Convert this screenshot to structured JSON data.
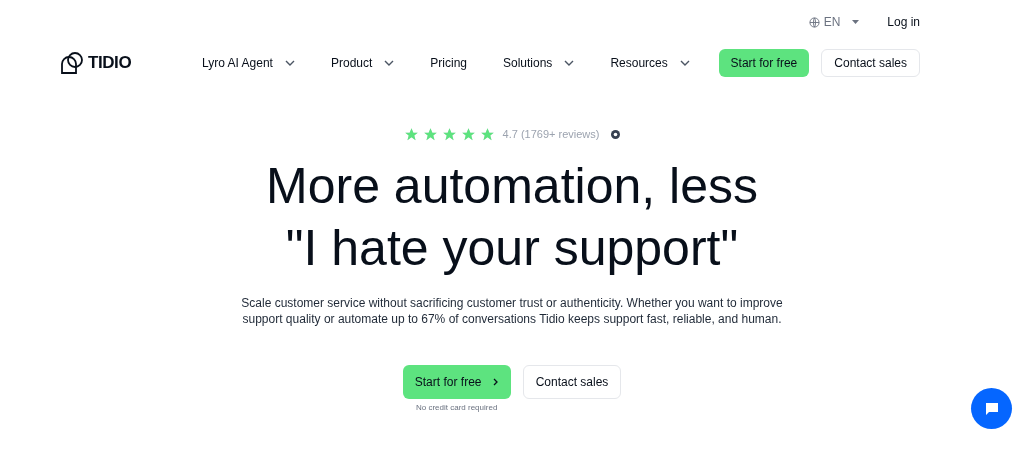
{
  "top_bar": {
    "language": "EN",
    "login": "Log in"
  },
  "nav": {
    "logo": "TIDIO",
    "items": [
      {
        "label": "Lyro AI Agent",
        "dropdown": true
      },
      {
        "label": "Product",
        "dropdown": true
      },
      {
        "label": "Pricing",
        "dropdown": false
      },
      {
        "label": "Solutions",
        "dropdown": true
      },
      {
        "label": "Resources",
        "dropdown": true
      }
    ],
    "primary": "Start for free",
    "secondary": "Contact sales"
  },
  "hero": {
    "rating": {
      "stars": 5,
      "text": "4.7 (1769+ reviews)"
    },
    "headline": [
      "More automation, less",
      "\"I hate your support\""
    ],
    "body": "Scale customer service without sacrificing customer trust or authenticity. Whether you want to improve support quality or automate up to 67% of conversations Tidio keeps support fast, reliable, and human.",
    "primary": "Start for free",
    "secondary": "Contact sales",
    "note": "No credit card required"
  }
}
